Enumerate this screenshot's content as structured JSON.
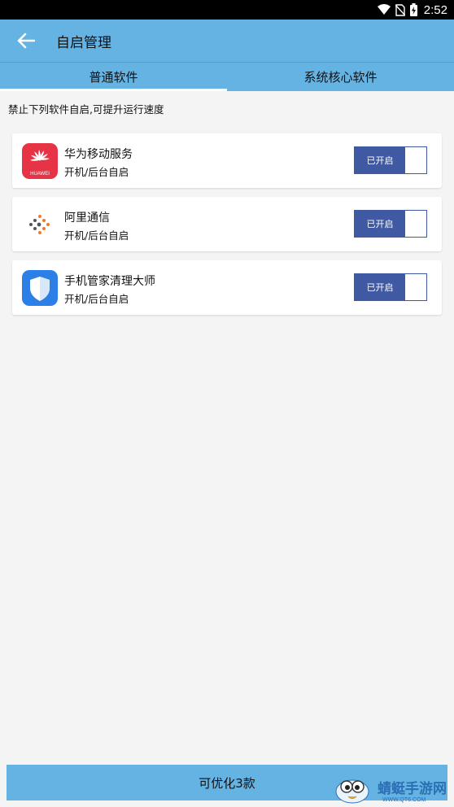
{
  "status_bar": {
    "time": "2:52",
    "icons": [
      "wifi-icon",
      "no-sim-icon",
      "battery-charging-icon"
    ]
  },
  "app_bar": {
    "title": "自启管理",
    "back_icon": "arrow-left-icon"
  },
  "tabs": [
    {
      "label": "普通软件",
      "active": true
    },
    {
      "label": "系统核心软件",
      "active": false
    }
  ],
  "hint": "禁止下列软件自启,可提升运行速度",
  "apps": [
    {
      "name": "华为移动服务",
      "subtitle": "开机/后台自启",
      "toggle_label": "已开启",
      "icon": "huawei-logo-icon",
      "icon_text": "HUAWEI"
    },
    {
      "name": "阿里通信",
      "subtitle": "开机/后台自启",
      "toggle_label": "已开启",
      "icon": "ali-telecom-icon"
    },
    {
      "name": "手机管家清理大师",
      "subtitle": "开机/后台自启",
      "toggle_label": "已开启",
      "icon": "shield-icon"
    }
  ],
  "bottom_button": {
    "label": "可优化3款"
  },
  "watermark": {
    "text": "蜻蜓手游网",
    "url": "WWW.QT6.COM"
  },
  "colors": {
    "primary": "#65b3e3",
    "toggle": "#3f59a3",
    "background": "#f4f4f4"
  }
}
